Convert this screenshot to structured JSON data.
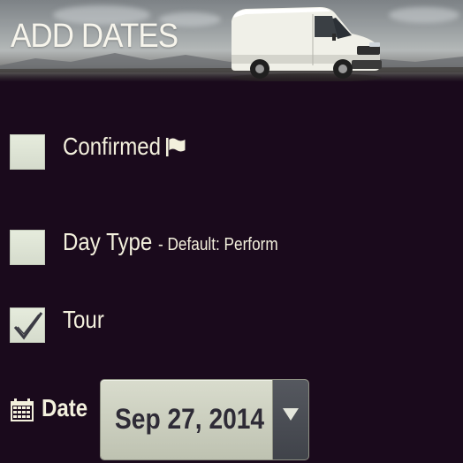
{
  "header": {
    "title": "ADD DATES"
  },
  "fields": {
    "confirmed": {
      "label": "Confirmed",
      "checked": false
    },
    "day_type": {
      "label": "Day Type",
      "sublabel": "- Default: Perform",
      "checked": false
    },
    "tour": {
      "label": "Tour",
      "checked": true
    }
  },
  "date": {
    "label": "Date",
    "value": "Sep 27, 2014"
  },
  "icons": {
    "confirmed_flag": "flag-icon",
    "date": "calendar-icon",
    "dropdown": "chevron-down-icon",
    "check": "checkmark-icon"
  },
  "colors": {
    "background": "#1a0a1c",
    "text": "#f3f0dd",
    "checkbox": "#dfe5d6",
    "select_field": "#cfd2c2",
    "select_button": "#4a4d54"
  }
}
